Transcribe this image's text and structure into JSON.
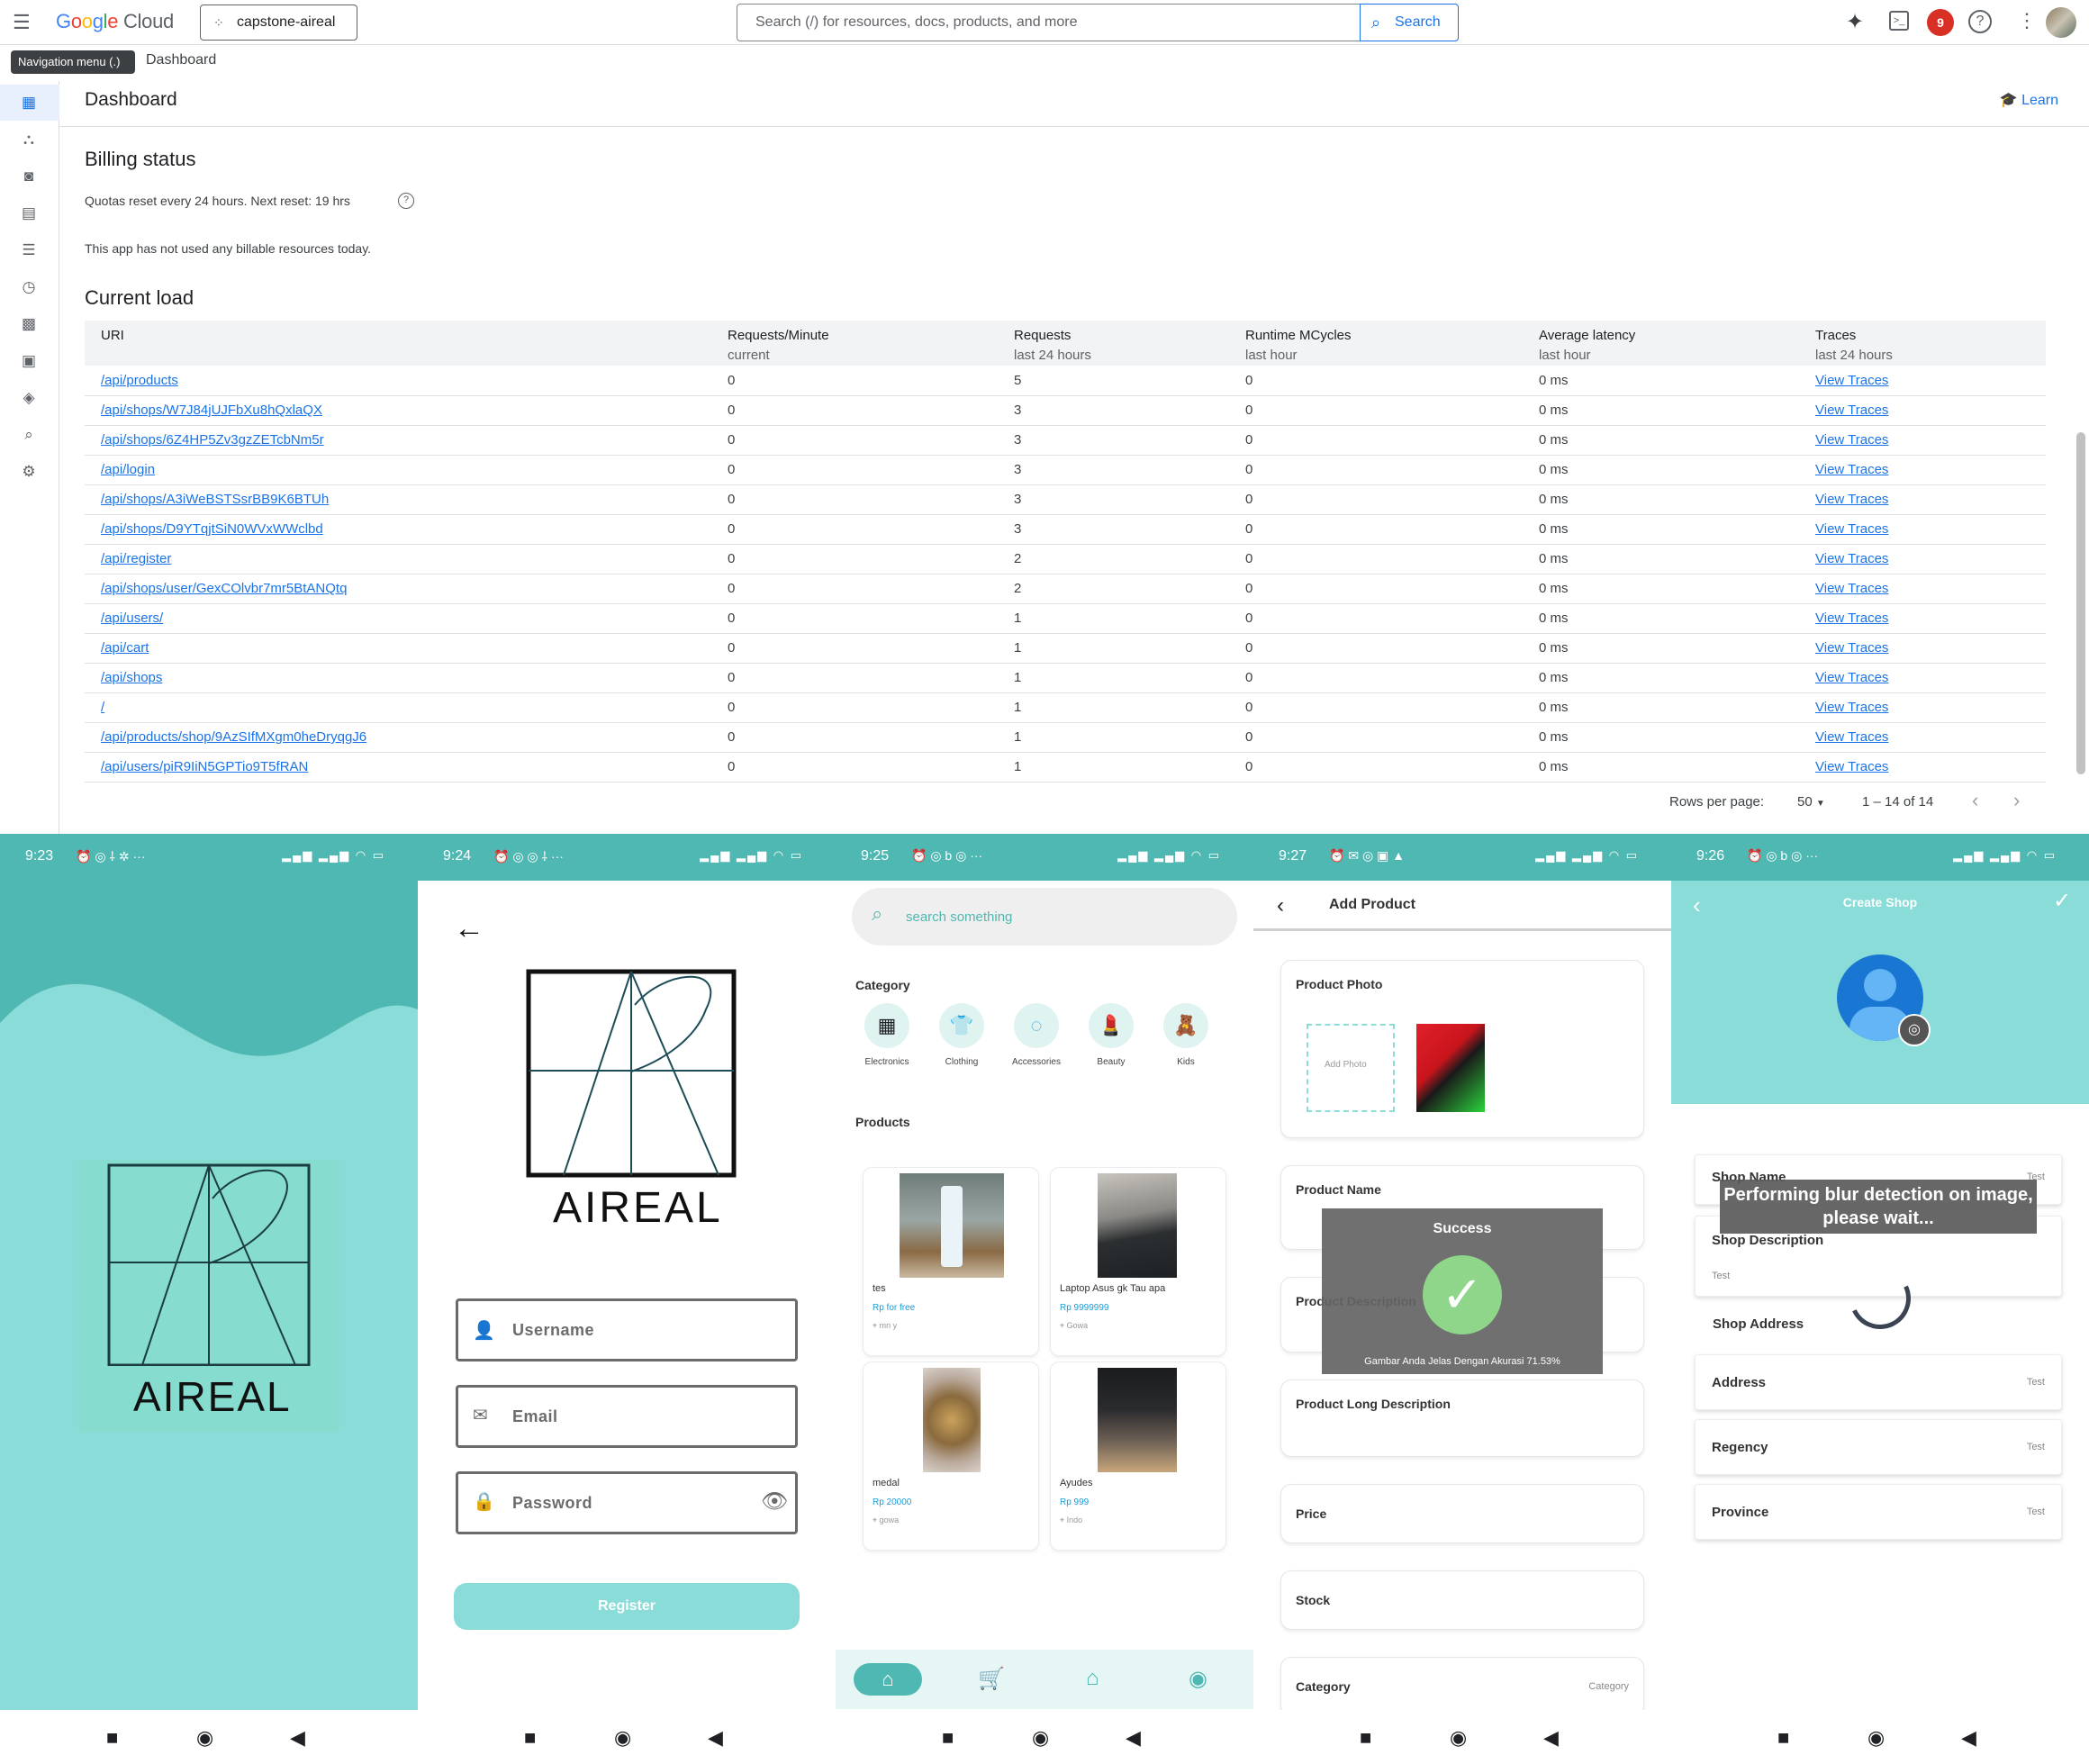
{
  "gcp": {
    "logo_google": "Google",
    "logo_cloud": "Cloud",
    "project": "capstone-aireal",
    "search_placeholder": "Search (/) for resources, docs, products, and more",
    "search_button": "Search",
    "notification_count": "9",
    "tooltip": "Navigation menu (.)",
    "breadcrumb": "Dashboard",
    "page_title": "Dashboard",
    "learn": "Learn",
    "billing_title": "Billing status",
    "quota_text": "Quotas reset every 24 hours. Next reset: 19 hrs",
    "billing_text": "This app has not used any billable resources today.",
    "load_title": "Current load",
    "columns": [
      {
        "label": "URI",
        "sub": ""
      },
      {
        "label": "Requests/Minute",
        "sub": "current"
      },
      {
        "label": "Requests",
        "sub": "last 24 hours"
      },
      {
        "label": "Runtime MCycles",
        "sub": "last hour"
      },
      {
        "label": "Average latency",
        "sub": "last hour"
      },
      {
        "label": "Traces",
        "sub": "last 24 hours"
      }
    ],
    "rows": [
      {
        "uri": "/api/products",
        "rpm": "0",
        "req": "5",
        "mc": "0",
        "lat": "0 ms",
        "tr": "View Traces"
      },
      {
        "uri": "/api/shops/W7J84jUJFbXu8hQxlaQX",
        "rpm": "0",
        "req": "3",
        "mc": "0",
        "lat": "0 ms",
        "tr": "View Traces"
      },
      {
        "uri": "/api/shops/6Z4HP5Zv3gzZETcbNm5r",
        "rpm": "0",
        "req": "3",
        "mc": "0",
        "lat": "0 ms",
        "tr": "View Traces"
      },
      {
        "uri": "/api/login",
        "rpm": "0",
        "req": "3",
        "mc": "0",
        "lat": "0 ms",
        "tr": "View Traces"
      },
      {
        "uri": "/api/shops/A3iWeBSTSsrBB9K6BTUh",
        "rpm": "0",
        "req": "3",
        "mc": "0",
        "lat": "0 ms",
        "tr": "View Traces"
      },
      {
        "uri": "/api/shops/D9YTqjtSiN0WVxWWclbd",
        "rpm": "0",
        "req": "3",
        "mc": "0",
        "lat": "0 ms",
        "tr": "View Traces"
      },
      {
        "uri": "/api/register",
        "rpm": "0",
        "req": "2",
        "mc": "0",
        "lat": "0 ms",
        "tr": "View Traces"
      },
      {
        "uri": "/api/shops/user/GexCOlvbr7mr5BtANQtq",
        "rpm": "0",
        "req": "2",
        "mc": "0",
        "lat": "0 ms",
        "tr": "View Traces"
      },
      {
        "uri": "/api/users/",
        "rpm": "0",
        "req": "1",
        "mc": "0",
        "lat": "0 ms",
        "tr": "View Traces"
      },
      {
        "uri": "/api/cart",
        "rpm": "0",
        "req": "1",
        "mc": "0",
        "lat": "0 ms",
        "tr": "View Traces"
      },
      {
        "uri": "/api/shops",
        "rpm": "0",
        "req": "1",
        "mc": "0",
        "lat": "0 ms",
        "tr": "View Traces"
      },
      {
        "uri": "/",
        "rpm": "0",
        "req": "1",
        "mc": "0",
        "lat": "0 ms",
        "tr": "View Traces"
      },
      {
        "uri": "/api/products/shop/9AzSIfMXgm0heDryqgJ6",
        "rpm": "0",
        "req": "1",
        "mc": "0",
        "lat": "0 ms",
        "tr": "View Traces"
      },
      {
        "uri": "/api/users/piR9IiN5GPTio9T5fRAN",
        "rpm": "0",
        "req": "1",
        "mc": "0",
        "lat": "0 ms",
        "tr": "View Traces"
      }
    ],
    "rows_per_page_label": "Rows per page:",
    "rows_per_page": "50",
    "range": "1 – 14 of 14"
  },
  "colors": {
    "teal": "#4fb8b2",
    "teal_light": "#8adcd8",
    "gcp_blue": "#1a73e8"
  },
  "phones": {
    "splash": {
      "time": "9:23",
      "brand": "AIREAL"
    },
    "register": {
      "time": "9:24",
      "brand": "AIREAL",
      "username_placeholder": "Username",
      "email_placeholder": "Email",
      "password_placeholder": "Password",
      "button": "Register"
    },
    "home": {
      "time": "9:25",
      "search_placeholder": "search something",
      "category_title": "Category",
      "categories": [
        "Electronics",
        "Clothing",
        "Accessories",
        "Beauty",
        "Kids"
      ],
      "products_title": "Products",
      "products": [
        {
          "name": "tes",
          "price": "Rp for free",
          "loc": "mn y"
        },
        {
          "name": "Laptop Asus gk Tau apa",
          "price": "Rp 9999999",
          "loc": "Gowa"
        },
        {
          "name": "medal",
          "price": "Rp 20000",
          "loc": "gowa"
        },
        {
          "name": "Ayudes",
          "price": "Rp 999",
          "loc": "Indo"
        }
      ]
    },
    "add_product": {
      "time": "9:27",
      "title": "Add Product",
      "photo_label": "Product Photo",
      "add_photo": "Add Photo",
      "name_label": "Product Name",
      "desc_label": "Product Description",
      "long_desc_label": "Product Long Description",
      "price_label": "Price",
      "stock_label": "Stock",
      "category_label": "Category",
      "category_hint": "Category",
      "dialog_title": "Success",
      "dialog_text": "Gambar Anda Jelas Dengan Akurasi 71.53%"
    },
    "create_shop": {
      "time": "9:26",
      "title": "Create Shop",
      "name_label": "Shop Name",
      "name_value": "Test",
      "loading_text": "Performing blur detection on image, please wait...",
      "desc_label": "Shop Description",
      "desc_value": "Test",
      "address_title": "Shop Address",
      "fields": [
        {
          "label": "Address",
          "value": "Test"
        },
        {
          "label": "Regency",
          "value": "Test"
        },
        {
          "label": "Province",
          "value": "Test"
        }
      ]
    }
  }
}
